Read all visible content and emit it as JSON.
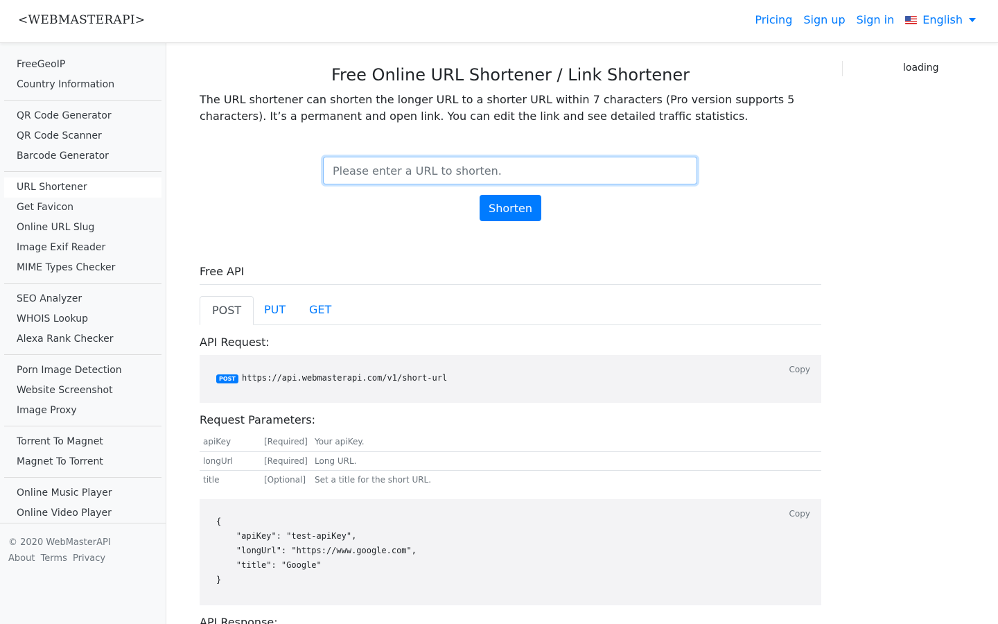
{
  "header": {
    "brand": "<WEBMASTERAPI>",
    "nav": [
      {
        "label": "Pricing"
      },
      {
        "label": "Sign up"
      },
      {
        "label": "Sign in"
      }
    ],
    "language": "English",
    "accent_color": "#007bff"
  },
  "sidebar": {
    "groups": [
      [
        "FreeGeoIP",
        "Country Information"
      ],
      [
        "QR Code Generator",
        "QR Code Scanner",
        "Barcode Generator"
      ],
      [
        "URL Shortener",
        "Get Favicon",
        "Online URL Slug",
        "Image Exif Reader",
        "MIME Types Checker"
      ],
      [
        "SEO Analyzer",
        "WHOIS Lookup",
        "Alexa Rank Checker"
      ],
      [
        "Porn Image Detection",
        "Website Screenshot",
        "Image Proxy"
      ],
      [
        "Torrent To Magnet",
        "Magnet To Torrent"
      ],
      [
        "Online Music Player",
        "Online Video Player"
      ]
    ],
    "active_item": "URL Shortener",
    "footer": {
      "copyright": "© 2020 WebMasterAPI",
      "links": [
        "About",
        "Terms",
        "Privacy"
      ]
    }
  },
  "main": {
    "title": "Free Online URL Shortener / Link Shortener",
    "description": "The URL shortener can shorten the longer URL to a shorter URL within 7 characters (Pro version supports 5 characters). It’s a permanent and open link. You can edit the link and see detailed traffic statistics.",
    "url_input": {
      "value": "",
      "placeholder": "Please enter a URL to shorten."
    },
    "shorten_button": "Shorten",
    "api_heading": "Free API",
    "tabs": [
      {
        "label": "POST"
      },
      {
        "label": "PUT"
      },
      {
        "label": "GET"
      }
    ],
    "active_tab": "POST",
    "request_label": "API Request:",
    "request": {
      "method": "POST",
      "endpoint": "https://api.webmasterapi.com/v1/short-url",
      "copy_label": "Copy"
    },
    "params_label": "Request Parameters:",
    "params": [
      {
        "name": "apiKey",
        "req": "[Required]",
        "desc": "Your apiKey."
      },
      {
        "name": "longUrl",
        "req": "[Required]",
        "desc": "Long URL."
      },
      {
        "name": "title",
        "req": "[Optional]",
        "desc": "Set a title for the short URL."
      }
    ],
    "example_body": "{\n    \"apiKey\": \"test-apiKey\",\n    \"longUrl\": \"https://www.google.com\",\n    \"title\": \"Google\"\n}",
    "example_copy_label": "Copy",
    "response_label": "API Response:"
  },
  "right_panel": {
    "status": "loading"
  }
}
